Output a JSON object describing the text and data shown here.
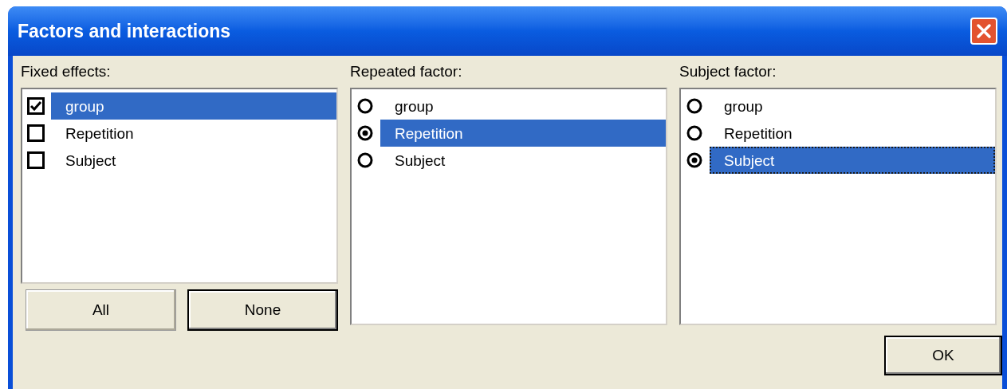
{
  "window": {
    "title": "Factors and interactions"
  },
  "lists": [
    {
      "kind": "check",
      "label": "Fixed effects:",
      "focused": false,
      "items": [
        {
          "label": "group",
          "checked": true,
          "selected": true
        },
        {
          "label": "Repetition",
          "checked": false,
          "selected": false
        },
        {
          "label": "Subject",
          "checked": false,
          "selected": false
        }
      ]
    },
    {
      "kind": "radio",
      "label": "Repeated factor:",
      "focused": false,
      "items": [
        {
          "label": "group",
          "selected": false
        },
        {
          "label": "Repetition",
          "selected": true
        },
        {
          "label": "Subject",
          "selected": false
        }
      ]
    },
    {
      "kind": "radio",
      "label": "Subject factor:",
      "focused": true,
      "items": [
        {
          "label": "group",
          "selected": false
        },
        {
          "label": "Repetition",
          "selected": false
        },
        {
          "label": "Subject",
          "selected": true
        }
      ]
    }
  ],
  "list_buttons": [
    {
      "label": "All",
      "default": false
    },
    {
      "label": "None",
      "default": true
    }
  ],
  "ok_button": {
    "label": "OK",
    "default": true
  }
}
